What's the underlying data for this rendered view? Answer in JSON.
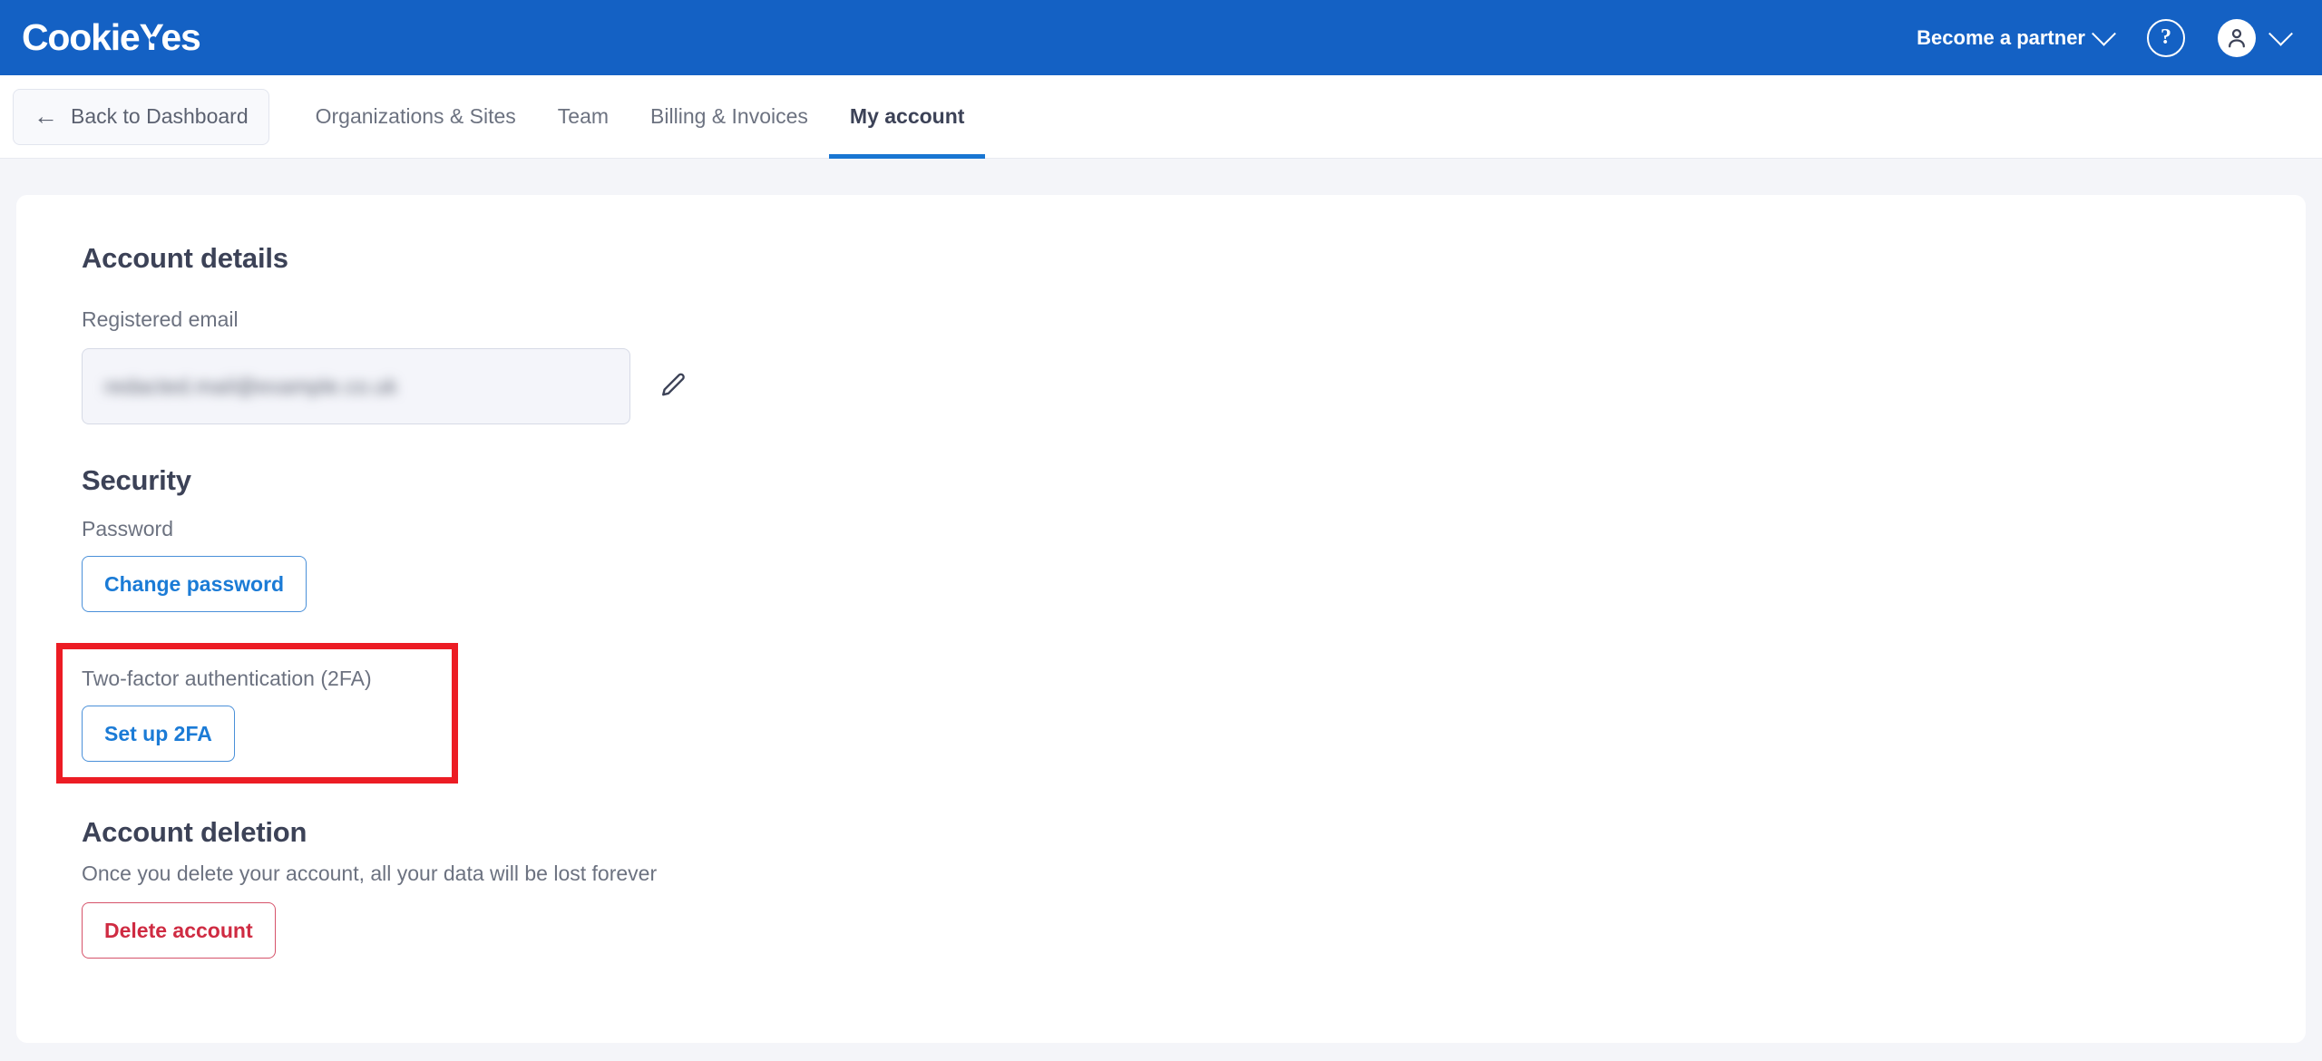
{
  "brand": {
    "logo_text_part1": "Cookie",
    "logo_text_part2": "Yes",
    "header_bg": "#1461c4",
    "accent_blue": "#1976d2",
    "danger_red": "#cf2b42",
    "highlight_red": "#ec1c24"
  },
  "header": {
    "partner_label": "Become a partner",
    "help_glyph": "?",
    "icons": {
      "chevron_down": "chevron-down-icon",
      "help": "help-circle-icon",
      "avatar": "user-avatar-icon"
    }
  },
  "nav": {
    "back_button": {
      "arrow": "←",
      "label": "Back to Dashboard"
    },
    "tabs": [
      {
        "label": "Organizations & Sites",
        "active": false
      },
      {
        "label": "Team",
        "active": false
      },
      {
        "label": "Billing & Invoices",
        "active": false
      },
      {
        "label": "My account",
        "active": true
      }
    ]
  },
  "account_details": {
    "title": "Account details",
    "email_label": "Registered email",
    "email_value": "redacted.mail@example.co.uk",
    "edit_icon": "pencil-icon"
  },
  "security": {
    "title": "Security",
    "password_label": "Password",
    "change_password_button": "Change password",
    "twofa_label": "Two-factor authentication (2FA)",
    "twofa_button": "Set up 2FA"
  },
  "account_deletion": {
    "title": "Account deletion",
    "description": "Once you delete your account, all your data will be lost forever",
    "delete_button": "Delete account"
  }
}
